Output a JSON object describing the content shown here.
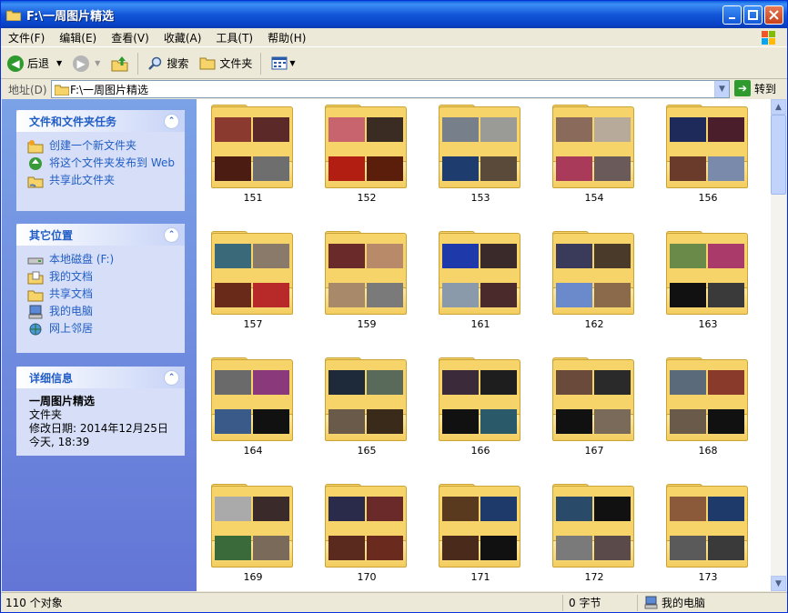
{
  "window": {
    "title": "F:\\一周图片精选"
  },
  "menu": [
    "文件(F)",
    "编辑(E)",
    "查看(V)",
    "收藏(A)",
    "工具(T)",
    "帮助(H)"
  ],
  "toolbar": {
    "back": "后退",
    "search": "搜索",
    "folders": "文件夹"
  },
  "address": {
    "label": "地址(D)",
    "path": "F:\\一周图片精选",
    "go": "转到"
  },
  "tasks": {
    "title": "文件和文件夹任务",
    "items": [
      "创建一个新文件夹",
      "将这个文件夹发布到 Web",
      "共享此文件夹"
    ]
  },
  "places": {
    "title": "其它位置",
    "items": [
      "本地磁盘 (F:)",
      "我的文档",
      "共享文档",
      "我的电脑",
      "网上邻居"
    ]
  },
  "details": {
    "title": "详细信息",
    "name": "一周图片精选",
    "type": "文件夹",
    "modified": "修改日期: 2014年12月25日",
    "time": "今天, 18:39"
  },
  "folders": [
    {
      "name": "151",
      "colors": [
        "#8a3a2e",
        "#5b2a28",
        "#4a1c12",
        "#6e6e6e"
      ]
    },
    {
      "name": "152",
      "colors": [
        "#c8646e",
        "#3a2c22",
        "#b21e12",
        "#5a1e0a"
      ]
    },
    {
      "name": "153",
      "colors": [
        "#77808a",
        "#9a9a96",
        "#1e3c6e",
        "#5a4a3a"
      ]
    },
    {
      "name": "154",
      "colors": [
        "#8a6a5a",
        "#b8aa9a",
        "#aa3a5a",
        "#6a5a5a"
      ]
    },
    {
      "name": "156",
      "colors": [
        "#1e2a5a",
        "#4a1e2a",
        "#6a3a2a",
        "#7a8aaa"
      ]
    },
    {
      "name": "157",
      "colors": [
        "#3a6a7a",
        "#8a7a6a",
        "#6a2a1a",
        "#b82a2a"
      ]
    },
    {
      "name": "159",
      "colors": [
        "#6a2a2a",
        "#b88a6a",
        "#a88a6a",
        "#7a7a7a"
      ]
    },
    {
      "name": "161",
      "colors": [
        "#1e3aaa",
        "#3a2a2a",
        "#8a9aaa",
        "#4a2a2a"
      ]
    },
    {
      "name": "162",
      "colors": [
        "#3a3a5a",
        "#4a3a2a",
        "#6a8acc",
        "#8a6a4a"
      ]
    },
    {
      "name": "163",
      "colors": [
        "#6a8a4a",
        "#aa3a6a",
        "#111111",
        "#3a3a3a"
      ]
    },
    {
      "name": "164",
      "colors": [
        "#6a6a6a",
        "#8a3a7a",
        "#3a5a8a",
        "#111111"
      ]
    },
    {
      "name": "165",
      "colors": [
        "#1e2a3a",
        "#5a6a5a",
        "#6a5a4a",
        "#3a2a1a"
      ]
    },
    {
      "name": "166",
      "colors": [
        "#3a2a3a",
        "#1e1e1e",
        "#111111",
        "#2a5a6a"
      ]
    },
    {
      "name": "167",
      "colors": [
        "#6a4a3a",
        "#2a2a2a",
        "#111111",
        "#7a6a5a"
      ]
    },
    {
      "name": "168",
      "colors": [
        "#5a6a7a",
        "#8a3a2a",
        "#6a5a4a",
        "#111111"
      ]
    },
    {
      "name": "169",
      "colors": [
        "#aaaaaa",
        "#3a2a2a",
        "#3a6a3a",
        "#7a6a5a"
      ]
    },
    {
      "name": "170",
      "colors": [
        "#2a2a4a",
        "#6a2a2a",
        "#5a2a1e",
        "#6a2a1e"
      ]
    },
    {
      "name": "171",
      "colors": [
        "#5a3a1e",
        "#1e3a6a",
        "#4a2a1a",
        "#111111"
      ]
    },
    {
      "name": "172",
      "colors": [
        "#2a4a6a",
        "#111111",
        "#7a7a7a",
        "#5a4a4a"
      ]
    },
    {
      "name": "173",
      "colors": [
        "#8a5a3a",
        "#1e3a6a",
        "#5a5a5a",
        "#3a3a3a"
      ]
    }
  ],
  "status": {
    "count": "110 个对象",
    "size": "0 字节",
    "location": "我的电脑"
  }
}
